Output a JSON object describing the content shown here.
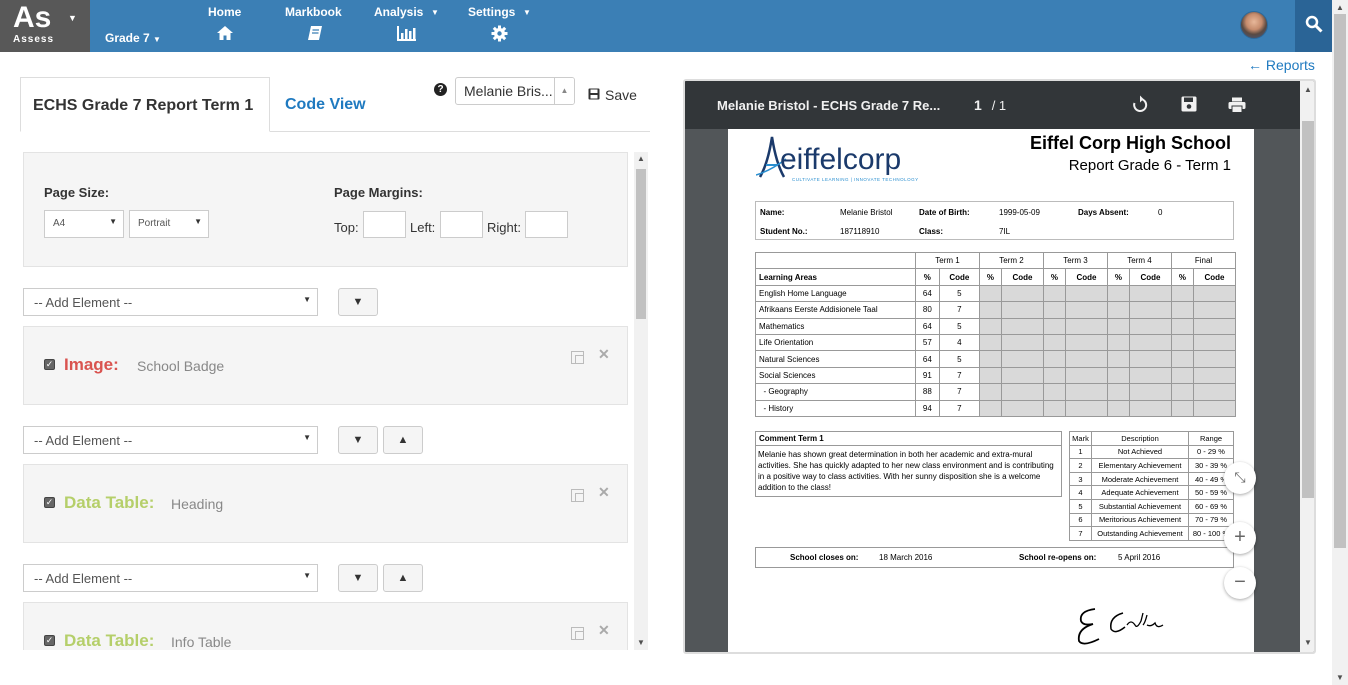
{
  "nav": {
    "logo": "As",
    "logo_sub": "Assess",
    "grade": "Grade 7",
    "items": [
      {
        "label": "Home",
        "icon": "home-icon"
      },
      {
        "label": "Markbook",
        "icon": "book-icon"
      },
      {
        "label": "Analysis",
        "icon": "bar-chart-icon"
      },
      {
        "label": "Settings",
        "icon": "gear-icon"
      }
    ]
  },
  "tabs": {
    "active": "ECHS Grade 7 Report Term 1",
    "code": "Code View"
  },
  "toolbar": {
    "student": "Melanie Bris...",
    "save": "Save"
  },
  "page_settings": {
    "page_size_label": "Page Size:",
    "size": "A4",
    "orientation": "Portrait",
    "margins_label": "Page Margins:",
    "top": "Top:",
    "left": "Left:",
    "right": "Right:"
  },
  "add_element": "-- Add Element --",
  "elements": [
    {
      "type": "Image:",
      "name": "School Badge",
      "color": "#d9534f"
    },
    {
      "type": "Data Table:",
      "name": "Heading",
      "color": "#b5cf6a"
    },
    {
      "type": "Data Table:",
      "name": "Info Table",
      "color": "#b5cf6a"
    }
  ],
  "reports_link": "← Reports",
  "pdf": {
    "title": "Melanie Bristol - ECHS Grade 7 Re...",
    "page": "1",
    "of": "/ 1"
  },
  "report": {
    "logo_text": "eiffelcorp",
    "logo_tagline": "CULTIVATE LEARNING | INNOVATE TECHNOLOGY",
    "school": "Eiffel Corp High School",
    "subtitle": "Report Grade 6 - Term 1",
    "info": {
      "name_label": "Name:",
      "name": "Melanie Bristol",
      "dob_label": "Date of Birth:",
      "dob": "1999-05-09",
      "absent_label": "Days Absent:",
      "absent": "0",
      "student_no_label": "Student No.:",
      "student_no": "187118910",
      "class_label": "Class:",
      "class": "7IL"
    },
    "terms": [
      "Term 1",
      "Term 2",
      "Term 3",
      "Term 4",
      "Final"
    ],
    "areas_header": "Learning Areas",
    "pct": "%",
    "code": "Code",
    "subjects": [
      {
        "name": "English Home Language",
        "pct": "64",
        "code": "5"
      },
      {
        "name": "Afrikaans Eerste Addisionele Taal",
        "pct": "80",
        "code": "7"
      },
      {
        "name": "Mathematics",
        "pct": "64",
        "code": "5"
      },
      {
        "name": "Life Orientation",
        "pct": "57",
        "code": "4"
      },
      {
        "name": "Natural Sciences",
        "pct": "64",
        "code": "5"
      },
      {
        "name": "Social Sciences",
        "pct": "91",
        "code": "7"
      },
      {
        "name": "  - Geography",
        "pct": "88",
        "code": "7"
      },
      {
        "name": "  - History",
        "pct": "94",
        "code": "7"
      }
    ],
    "comment_title": "Comment Term 1",
    "comment": "Melanie has shown great determination in both her academic and extra-mural activities. She has quickly adapted to her new class environment and is contributing in a positive way to class activities. With her sunny disposition she is a welcome addition to the class!",
    "codes_header": {
      "mark": "Mark",
      "desc": "Description",
      "range": "Range"
    },
    "codes": [
      {
        "mark": "1",
        "desc": "Not Achieved",
        "range": "0 - 29 %"
      },
      {
        "mark": "2",
        "desc": "Elementary Achievement",
        "range": "30 - 39 %"
      },
      {
        "mark": "3",
        "desc": "Moderate Achievement",
        "range": "40 - 49 %"
      },
      {
        "mark": "4",
        "desc": "Adequate Achievement",
        "range": "50 - 59 %"
      },
      {
        "mark": "5",
        "desc": "Substantial Achievement",
        "range": "60 - 69 %"
      },
      {
        "mark": "6",
        "desc": "Meritorious Achievement",
        "range": "70 - 79 %"
      },
      {
        "mark": "7",
        "desc": "Outstanding Achievement",
        "range": "80 - 100 %"
      }
    ],
    "closes_label": "School closes on:",
    "closes": "18 March 2016",
    "reopens_label": "School re-opens on:",
    "reopens": "5 April 2016"
  }
}
